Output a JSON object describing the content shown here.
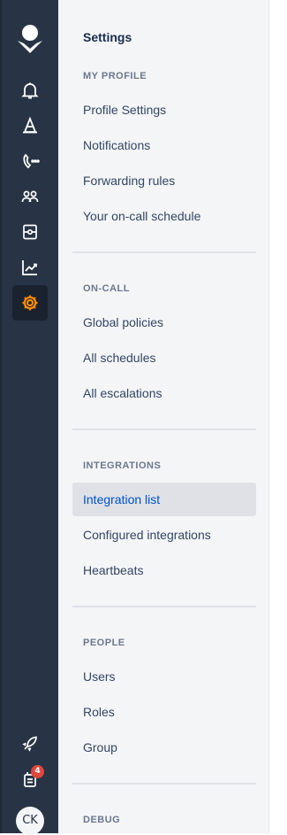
{
  "rail": {
    "logo_icon": "opsgenie-logo-icon",
    "items": [
      {
        "icon": "bell-icon"
      },
      {
        "icon": "alert-cone-icon"
      },
      {
        "icon": "phone-icon"
      },
      {
        "icon": "team-icon"
      },
      {
        "icon": "service-icon"
      },
      {
        "icon": "analytics-icon"
      },
      {
        "icon": "settings-gear-icon",
        "active": true,
        "color": "#ff8b00"
      }
    ],
    "bottom": {
      "rocket_icon": "rocket-icon",
      "notifications_badge": "4",
      "avatar_initials": "CK"
    }
  },
  "panel": {
    "title": "Settings",
    "sections": [
      {
        "heading": "MY PROFILE",
        "items": [
          "Profile Settings",
          "Notifications",
          "Forwarding rules",
          "Your on-call schedule"
        ]
      },
      {
        "heading": "ON-CALL",
        "items": [
          "Global policies",
          "All schedules",
          "All escalations"
        ]
      },
      {
        "heading": "INTEGRATIONS",
        "items": [
          "Integration list",
          "Configured integrations",
          "Heartbeats"
        ],
        "active_index": 0
      },
      {
        "heading": "PEOPLE",
        "items": [
          "Users",
          "Roles",
          "Group"
        ]
      },
      {
        "heading": "DEBUG",
        "items": []
      }
    ]
  },
  "colors": {
    "rail_bg": "#283446",
    "panel_bg": "#f4f5f7",
    "active_item_bg": "#dfe1e6",
    "active_item_text": "#0052cc",
    "accent": "#ff8b00"
  }
}
